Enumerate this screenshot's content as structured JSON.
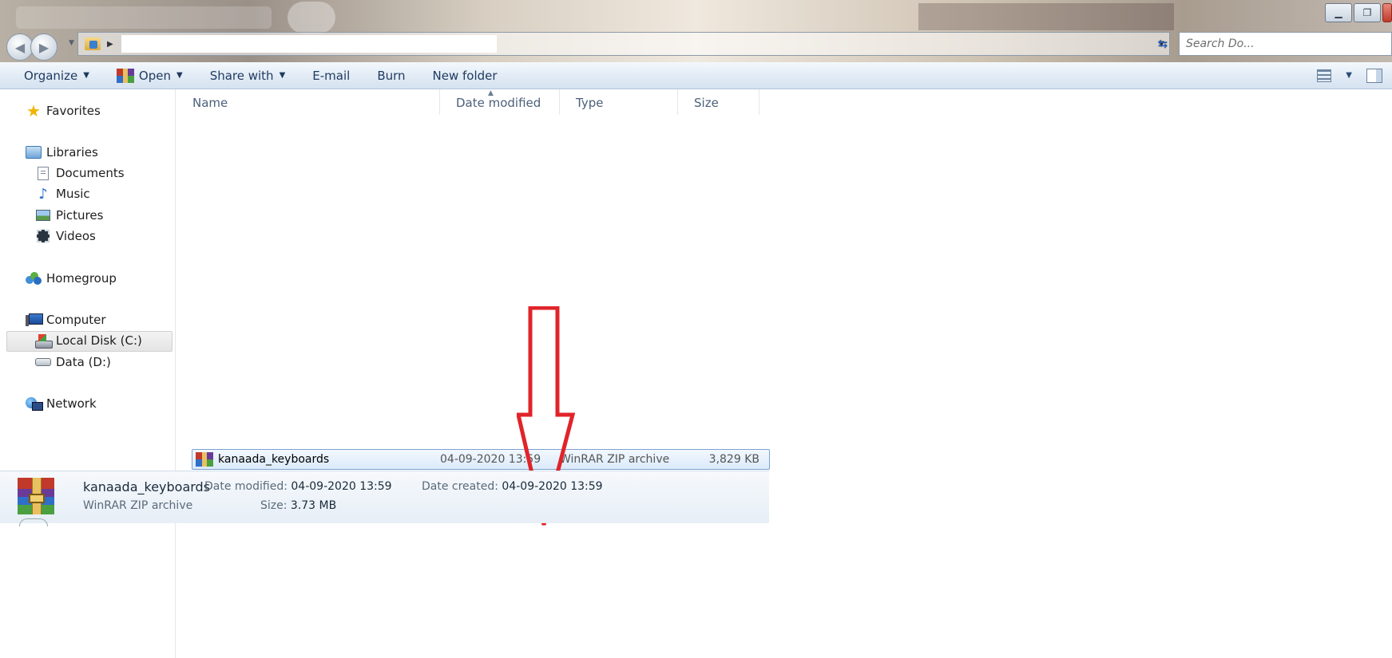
{
  "window": {
    "minimize_icon": "minimize-icon",
    "restore_icon": "restore-icon",
    "close_icon": "close-icon"
  },
  "address_bar": {
    "path_value": "",
    "search_placeholder": "Search Do..."
  },
  "toolbar": {
    "organize": "Organize",
    "open": "Open",
    "share_with": "Share with",
    "email": "E-mail",
    "burn": "Burn",
    "new_folder": "New folder"
  },
  "nav": {
    "favorites": "Favorites",
    "libraries": "Libraries",
    "documents": "Documents",
    "music": "Music",
    "pictures": "Pictures",
    "videos": "Videos",
    "homegroup": "Homegroup",
    "computer": "Computer",
    "local_disk": "Local Disk (C:)",
    "data_disk": "Data (D:)",
    "network": "Network"
  },
  "columns": {
    "name": "Name",
    "date_modified": "Date modified",
    "type": "Type",
    "size": "Size"
  },
  "file": {
    "name": "kanaada_keyboards",
    "date_modified": "04-09-2020 13:59",
    "type": "WinRAR ZIP archive",
    "size": "3,829 KB"
  },
  "details": {
    "name": "kanaada_keyboards",
    "date_modified_label": "Date modified:",
    "date_modified": "04-09-2020 13:59",
    "date_created_label": "Date created:",
    "date_created": "04-09-2020 13:59",
    "type": "WinRAR ZIP archive",
    "size_label": "Size:",
    "size": "3.73 MB"
  },
  "colors": {
    "arrow": "#e0242a",
    "selection_border": "#7da2ce",
    "toolbar_text": "#1e3a5f"
  }
}
